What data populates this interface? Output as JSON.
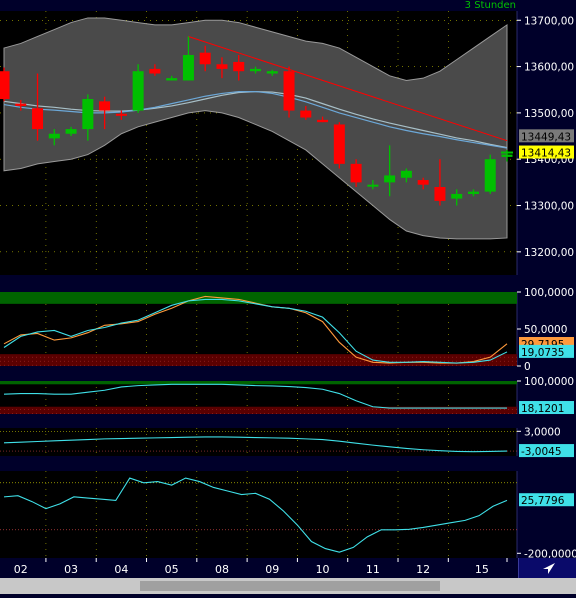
{
  "header": {
    "timeframe": "3 Stunden"
  },
  "colors": {
    "background": "#00002a",
    "panel_bg": "#000000",
    "band_fill": "#4a4a4a",
    "up_candle": "#00c000",
    "down_candle": "#ff0000",
    "trendline": "#ff0000",
    "cyan": "#3fe0e8",
    "orange": "#ff9a3c",
    "overbought_zone": "#006400",
    "oversold_zone": "#5a0000",
    "axis_text": "#ffffff",
    "gridline": "#b8b800"
  },
  "x_axis": {
    "labels": [
      "02",
      "03",
      "04",
      "05",
      "08",
      "09",
      "10",
      "11",
      "12",
      "15"
    ]
  },
  "chart_data": [
    {
      "type": "candlestick",
      "panel": "price",
      "ylim": [
        13150,
        13720
      ],
      "yticks": [
        "13200,00",
        "13300,00",
        "13400,00",
        "13500,00",
        "13600,00",
        "13700,00"
      ],
      "value_tags": [
        {
          "text": "13449,43",
          "value": 13449.43,
          "tag_bg": "#7a7a7a",
          "tag_fg": "#000000"
        },
        {
          "text": "13414,43",
          "value": 13414.43,
          "tag_bg": "#ffff00",
          "tag_fg": "#000000"
        }
      ],
      "candles": [
        {
          "o": 13590,
          "h": 13598,
          "l": 13525,
          "c": 13530
        },
        {
          "o": 13520,
          "h": 13528,
          "l": 13505,
          "c": 13515
        },
        {
          "o": 13510,
          "h": 13585,
          "l": 13440,
          "c": 13465
        },
        {
          "o": 13445,
          "h": 13465,
          "l": 13430,
          "c": 13455
        },
        {
          "o": 13455,
          "h": 13470,
          "l": 13450,
          "c": 13465
        },
        {
          "o": 13465,
          "h": 13540,
          "l": 13440,
          "c": 13530
        },
        {
          "o": 13525,
          "h": 13535,
          "l": 13465,
          "c": 13505
        },
        {
          "o": 13498,
          "h": 13505,
          "l": 13485,
          "c": 13495
        },
        {
          "o": 13505,
          "h": 13605,
          "l": 13500,
          "c": 13590
        },
        {
          "o": 13595,
          "h": 13605,
          "l": 13580,
          "c": 13585
        },
        {
          "o": 13570,
          "h": 13580,
          "l": 13570,
          "c": 13575
        },
        {
          "o": 13570,
          "h": 13665,
          "l": 13570,
          "c": 13625
        },
        {
          "o": 13630,
          "h": 13645,
          "l": 13590,
          "c": 13605
        },
        {
          "o": 13605,
          "h": 13620,
          "l": 13575,
          "c": 13595
        },
        {
          "o": 13610,
          "h": 13625,
          "l": 13570,
          "c": 13590
        },
        {
          "o": 13590,
          "h": 13600,
          "l": 13585,
          "c": 13595
        },
        {
          "o": 13585,
          "h": 13593,
          "l": 13580,
          "c": 13590
        },
        {
          "o": 13590,
          "h": 13600,
          "l": 13490,
          "c": 13505
        },
        {
          "o": 13505,
          "h": 13515,
          "l": 13485,
          "c": 13490
        },
        {
          "o": 13485,
          "h": 13492,
          "l": 13480,
          "c": 13480
        },
        {
          "o": 13475,
          "h": 13480,
          "l": 13380,
          "c": 13390
        },
        {
          "o": 13390,
          "h": 13400,
          "l": 13340,
          "c": 13350
        },
        {
          "o": 13345,
          "h": 13355,
          "l": 13335,
          "c": 13345
        },
        {
          "o": 13350,
          "h": 13430,
          "l": 13320,
          "c": 13365
        },
        {
          "o": 13360,
          "h": 13380,
          "l": 13350,
          "c": 13375
        },
        {
          "o": 13355,
          "h": 13360,
          "l": 13335,
          "c": 13345
        },
        {
          "o": 13340,
          "h": 13400,
          "l": 13300,
          "c": 13310
        },
        {
          "o": 13315,
          "h": 13335,
          "l": 13300,
          "c": 13325
        },
        {
          "o": 13325,
          "h": 13335,
          "l": 13320,
          "c": 13330
        },
        {
          "o": 13330,
          "h": 13410,
          "l": 13325,
          "c": 13400
        },
        {
          "o": 13405,
          "h": 13420,
          "l": 13395,
          "c": 13410
        }
      ],
      "band_upper": [
        13640,
        13650,
        13665,
        13680,
        13695,
        13705,
        13705,
        13700,
        13695,
        13690,
        13690,
        13695,
        13700,
        13700,
        13695,
        13685,
        13675,
        13665,
        13655,
        13650,
        13640,
        13620,
        13600,
        13580,
        13570,
        13575,
        13590,
        13615,
        13640,
        13665,
        13690
      ],
      "band_lower": [
        13375,
        13380,
        13390,
        13395,
        13400,
        13410,
        13430,
        13455,
        13470,
        13480,
        13490,
        13500,
        13505,
        13500,
        13490,
        13475,
        13460,
        13440,
        13420,
        13390,
        13360,
        13330,
        13300,
        13270,
        13245,
        13235,
        13230,
        13228,
        13228,
        13228,
        13230
      ],
      "ma_light": [
        13525,
        13520,
        13515,
        13512,
        13508,
        13505,
        13504,
        13504,
        13506,
        13510,
        13515,
        13522,
        13530,
        13538,
        13544,
        13546,
        13545,
        13540,
        13532,
        13520,
        13508,
        13497,
        13487,
        13478,
        13470,
        13462,
        13454,
        13446,
        13440,
        13432,
        13425
      ],
      "ma_blue": [
        13518,
        13512,
        13508,
        13506,
        13503,
        13500,
        13500,
        13502,
        13506,
        13512,
        13520,
        13528,
        13536,
        13542,
        13546,
        13546,
        13542,
        13534,
        13524,
        13512,
        13500,
        13490,
        13480,
        13470,
        13462,
        13455,
        13449,
        13442,
        13436,
        13430,
        13424
      ],
      "trendline": {
        "from": {
          "index": 11,
          "value": 13665
        },
        "to": {
          "index": 30,
          "value": 13440
        }
      }
    },
    {
      "type": "line",
      "panel": "oscillator_1",
      "ylim": [
        0,
        100
      ],
      "yticks": [
        "100,0000",
        "50,0000",
        "0"
      ],
      "zones": {
        "overbought": [
          84,
          100
        ],
        "oversold": [
          0,
          16
        ]
      },
      "value_tags": [
        {
          "text": "29,7195",
          "value": 29.7195,
          "tag_bg": "#ff9a3c",
          "tag_fg": "#000000"
        },
        {
          "text": "19,0735",
          "value": 19.0735,
          "tag_bg": "#3fe0e8",
          "tag_fg": "#000000"
        }
      ],
      "series": [
        {
          "color": "#ff9a3c",
          "values": [
            30,
            42,
            44,
            35,
            38,
            45,
            55,
            57,
            60,
            70,
            78,
            88,
            94,
            92,
            90,
            85,
            80,
            78,
            72,
            60,
            32,
            12,
            5,
            4,
            5,
            5,
            4,
            4,
            6,
            12,
            30
          ]
        },
        {
          "color": "#3fe0e8",
          "values": [
            25,
            40,
            46,
            48,
            40,
            48,
            52,
            58,
            62,
            72,
            82,
            88,
            90,
            90,
            88,
            84,
            80,
            78,
            74,
            66,
            45,
            20,
            8,
            5,
            5,
            6,
            5,
            4,
            5,
            8,
            19
          ]
        }
      ]
    },
    {
      "type": "line",
      "panel": "oscillator_2",
      "ylim": [
        0,
        100
      ],
      "yticks": [
        "100,0000"
      ],
      "zones": {
        "overbought": [
          90,
          100
        ],
        "oversold": [
          0,
          22
        ]
      },
      "value_tags": [
        {
          "text": "18,1201",
          "value": 18.1201,
          "tag_bg": "#3fe0e8",
          "tag_fg": "#000000"
        }
      ],
      "series": [
        {
          "color": "#3fe0e8",
          "values": [
            60,
            62,
            62,
            60,
            60,
            66,
            72,
            82,
            86,
            88,
            90,
            90,
            90,
            90,
            88,
            86,
            85,
            83,
            80,
            75,
            62,
            40,
            22,
            18,
            18,
            18,
            18,
            18,
            18,
            18,
            18
          ]
        }
      ]
    },
    {
      "type": "line",
      "panel": "oscillator_3",
      "ylim": [
        -4.5,
        4
      ],
      "yticks": [
        "3,0000"
      ],
      "reference_lines": [
        3,
        -3
      ],
      "value_tags": [
        {
          "text": "-3,0045",
          "value": -3.0045,
          "tag_bg": "#3fe0e8",
          "tag_fg": "#000000"
        }
      ],
      "series": [
        {
          "color": "#3fe0e8",
          "values": [
            -0.5,
            -0.3,
            -0.1,
            0.1,
            0.3,
            0.5,
            0.7,
            0.8,
            0.9,
            1.0,
            1.1,
            1.2,
            1.3,
            1.3,
            1.2,
            1.1,
            1.0,
            0.9,
            0.7,
            0.5,
            0.0,
            -0.6,
            -1.2,
            -1.7,
            -2.2,
            -2.6,
            -2.9,
            -3.1,
            -3.2,
            -3.1,
            -3.0
          ]
        }
      ]
    },
    {
      "type": "line",
      "panel": "cci",
      "ylim": [
        -220,
        150
      ],
      "yticks": [
        "-200,0000"
      ],
      "reference_lines": [
        100,
        -100
      ],
      "value_tags": [
        {
          "text": "25,7796",
          "value": 25.7796,
          "tag_bg": "#3fe0e8",
          "tag_fg": "#000000"
        }
      ],
      "series": [
        {
          "color": "#3fe0e8",
          "values": [
            40,
            45,
            20,
            -10,
            10,
            40,
            35,
            30,
            25,
            120,
            100,
            105,
            90,
            120,
            105,
            80,
            65,
            50,
            55,
            30,
            -20,
            -80,
            -150,
            -180,
            -195,
            -175,
            -130,
            -100,
            -100,
            -98,
            -90,
            -80,
            -70,
            -60,
            -40,
            0,
            25
          ]
        }
      ]
    }
  ]
}
